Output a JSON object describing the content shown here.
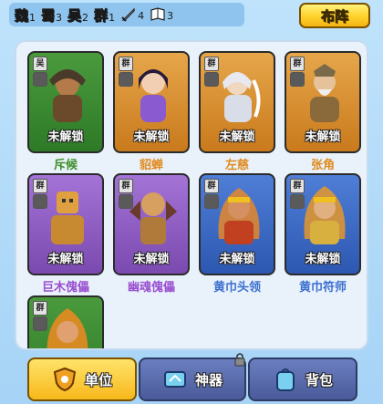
{
  "factions": [
    {
      "name": "魏",
      "count": "1"
    },
    {
      "name": "蜀",
      "count": "3"
    },
    {
      "name": "吴",
      "count": "2"
    },
    {
      "name": "群",
      "count": "1"
    }
  ],
  "unit_types": [
    {
      "icon": "sword-icon",
      "count": "4"
    },
    {
      "icon": "book-icon",
      "count": "3"
    }
  ],
  "buzhen_label": "布阵",
  "locked_label": "未解锁",
  "cards": [
    {
      "faction": "吴",
      "name": "斥候",
      "bg": "green",
      "name_color": "#3f8f2a"
    },
    {
      "faction": "群",
      "name": "貂蝉",
      "bg": "orange",
      "name_color": "#e08a1e"
    },
    {
      "faction": "群",
      "name": "左慈",
      "bg": "orange",
      "name_color": "#e08a1e"
    },
    {
      "faction": "群",
      "name": "张角",
      "bg": "orange",
      "name_color": "#e08a1e"
    },
    {
      "faction": "群",
      "name": "巨木傀儡",
      "bg": "purple",
      "name_color": "#9a4fd0"
    },
    {
      "faction": "群",
      "name": "幽魂傀儡",
      "bg": "purple",
      "name_color": "#9a4fd0"
    },
    {
      "faction": "群",
      "name": "黄巾头领",
      "bg": "blue",
      "name_color": "#3c6fcf"
    },
    {
      "faction": "群",
      "name": "黄巾符师",
      "bg": "blue",
      "name_color": "#3c6fcf"
    },
    {
      "faction": "群",
      "name": "",
      "bg": "green",
      "name_color": "#3f8f2a"
    }
  ],
  "bottom_buttons": [
    {
      "label": "单位",
      "icon": "shield-icon"
    },
    {
      "label": "神器",
      "icon": "artifact-icon"
    },
    {
      "label": "背包",
      "icon": "backpack-icon"
    }
  ],
  "colors": {
    "accent": "#ffd12a",
    "panel": "#e9f2fb"
  }
}
